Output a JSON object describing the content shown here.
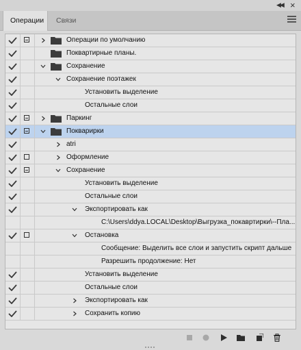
{
  "tabs": [
    {
      "label": "Операции"
    },
    {
      "label": "Связи"
    }
  ],
  "rows": [
    {
      "checked": true,
      "dialog": "filled",
      "indent": 0,
      "arrow": "right",
      "folder": true,
      "label": "Операции по умолчанию"
    },
    {
      "checked": true,
      "dialog": "none",
      "indent": 0,
      "arrow": "none",
      "folder": true,
      "label": "Поквартирные планы."
    },
    {
      "checked": true,
      "dialog": "none",
      "indent": 0,
      "arrow": "down",
      "folder": true,
      "label": "Сохранение"
    },
    {
      "checked": true,
      "dialog": "none",
      "indent": 1,
      "arrow": "down",
      "folder": false,
      "label": "Сохранение поэтажек"
    },
    {
      "checked": true,
      "dialog": "none",
      "indent": 2,
      "arrow": "none",
      "folder": false,
      "label": "Установить выделение"
    },
    {
      "checked": true,
      "dialog": "none",
      "indent": 2,
      "arrow": "none",
      "folder": false,
      "label": "Остальные слои"
    },
    {
      "checked": true,
      "dialog": "filled",
      "indent": 0,
      "arrow": "right",
      "folder": true,
      "label": "Паркинг"
    },
    {
      "checked": true,
      "dialog": "filled",
      "indent": 0,
      "arrow": "down",
      "folder": true,
      "label": "Покварирки",
      "selected": true
    },
    {
      "checked": true,
      "dialog": "none",
      "indent": 1,
      "arrow": "right",
      "folder": false,
      "label": "atri"
    },
    {
      "checked": true,
      "dialog": "empty",
      "indent": 1,
      "arrow": "right",
      "folder": false,
      "label": "Оформление"
    },
    {
      "checked": true,
      "dialog": "filled",
      "indent": 1,
      "arrow": "down",
      "folder": false,
      "label": "Сохранение"
    },
    {
      "checked": true,
      "dialog": "none",
      "indent": 2,
      "arrow": "none",
      "folder": false,
      "label": "Установить выделение"
    },
    {
      "checked": true,
      "dialog": "none",
      "indent": 2,
      "arrow": "none",
      "folder": false,
      "label": "Остальные слои"
    },
    {
      "checked": true,
      "dialog": "none",
      "indent": 2,
      "arrow": "down",
      "folder": false,
      "label": "Экспортировать как"
    },
    {
      "checked": false,
      "dialog": "none",
      "indent": 3,
      "arrow": "none",
      "folder": false,
      "label": "C:\\Users\\ddya.LOCAL\\Desktop\\Выгрузка_покавртирки\\--Пла..."
    },
    {
      "checked": true,
      "dialog": "empty",
      "indent": 2,
      "arrow": "down",
      "folder": false,
      "label": "Остановка"
    },
    {
      "checked": false,
      "dialog": "none",
      "indent": 3,
      "arrow": "none",
      "folder": false,
      "label": "Сообщение: Выделить все слои и запустить скрипт дальше"
    },
    {
      "checked": false,
      "dialog": "none",
      "indent": 3,
      "arrow": "none",
      "folder": false,
      "label": "Разрешить продолжение: Нет"
    },
    {
      "checked": true,
      "dialog": "none",
      "indent": 2,
      "arrow": "none",
      "folder": false,
      "label": "Установить выделение"
    },
    {
      "checked": true,
      "dialog": "none",
      "indent": 2,
      "arrow": "none",
      "folder": false,
      "label": "Остальные слои"
    },
    {
      "checked": true,
      "dialog": "none",
      "indent": 2,
      "arrow": "right",
      "folder": false,
      "label": "Экспортировать как"
    },
    {
      "checked": true,
      "dialog": "none",
      "indent": 2,
      "arrow": "right",
      "folder": false,
      "label": "Сохранить копию"
    }
  ],
  "toolbar": [
    {
      "name": "stop-icon",
      "enabled": false
    },
    {
      "name": "record-icon",
      "enabled": false
    },
    {
      "name": "play-icon",
      "enabled": true
    },
    {
      "name": "new-set-folder-icon",
      "enabled": true
    },
    {
      "name": "new-action-icon",
      "enabled": true
    },
    {
      "name": "trash-icon",
      "enabled": true
    }
  ],
  "colors": {
    "selected_row": "#bdd3ee",
    "panel": "#e6e6e6",
    "check": "#3a3a3a",
    "folder": "#3c3c3c"
  }
}
